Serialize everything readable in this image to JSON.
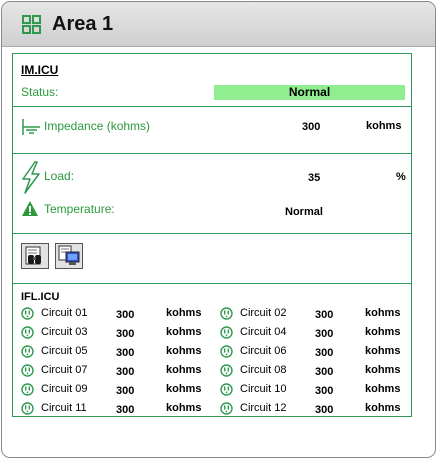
{
  "window": {
    "title": "Area 1",
    "icon": "grid-icon"
  },
  "device": {
    "name": "IM.ICU",
    "status_label": "Status:",
    "status_value": "Normal",
    "status_color": "#90ee90"
  },
  "impedance": {
    "label": "Impedance (kohms)",
    "value": "300",
    "unit": "kohms",
    "icon": "ground-icon"
  },
  "load": {
    "label": "Load:",
    "value": "35",
    "unit": "%",
    "icon": "lightning-icon"
  },
  "temperature": {
    "label": "Temperature:",
    "value": "Normal",
    "icon": "warning-icon"
  },
  "toolbar": {
    "buttons": [
      "binoculars-icon",
      "computer-monitor-icon"
    ]
  },
  "circuits": {
    "title": "IFL.ICU",
    "items": [
      {
        "name": "Circuit 01",
        "value": "300",
        "unit": "kohms"
      },
      {
        "name": "Circuit 02",
        "value": "300",
        "unit": "kohms"
      },
      {
        "name": "Circuit 03",
        "value": "300",
        "unit": "kohms"
      },
      {
        "name": "Circuit 04",
        "value": "300",
        "unit": "kohms"
      },
      {
        "name": "Circuit 05",
        "value": "300",
        "unit": "kohms"
      },
      {
        "name": "Circuit 06",
        "value": "300",
        "unit": "kohms"
      },
      {
        "name": "Circuit 07",
        "value": "300",
        "unit": "kohms"
      },
      {
        "name": "Circuit 08",
        "value": "300",
        "unit": "kohms"
      },
      {
        "name": "Circuit 09",
        "value": "300",
        "unit": "kohms"
      },
      {
        "name": "Circuit 10",
        "value": "300",
        "unit": "kohms"
      },
      {
        "name": "Circuit 11",
        "value": "300",
        "unit": "kohms"
      },
      {
        "name": "Circuit 12",
        "value": "300",
        "unit": "kohms"
      }
    ]
  }
}
